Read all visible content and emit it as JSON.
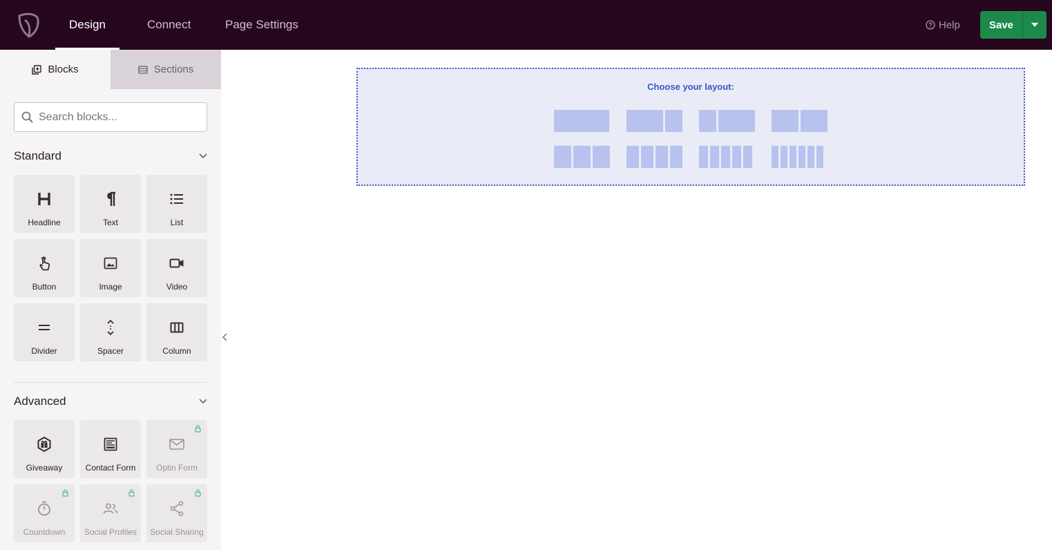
{
  "topbar": {
    "tabs": [
      {
        "label": "Design",
        "active": true
      },
      {
        "label": "Connect",
        "active": false
      },
      {
        "label": "Page Settings",
        "active": false
      }
    ],
    "help_label": "Help",
    "save_label": "Save",
    "accent_color": "#1b8a4b",
    "bar_color": "#270720"
  },
  "sidebar": {
    "tabs": [
      {
        "label": "Blocks",
        "icon": "blocks-icon",
        "active": true
      },
      {
        "label": "Sections",
        "icon": "sections-icon",
        "active": false
      }
    ],
    "search": {
      "placeholder": "Search blocks..."
    },
    "standard": {
      "title": "Standard",
      "blocks": [
        {
          "label": "Headline",
          "icon": "headline-icon"
        },
        {
          "label": "Text",
          "icon": "paragraph-icon"
        },
        {
          "label": "List",
          "icon": "list-icon"
        },
        {
          "label": "Button",
          "icon": "pointer-icon"
        },
        {
          "label": "Image",
          "icon": "image-icon"
        },
        {
          "label": "Video",
          "icon": "video-icon"
        },
        {
          "label": "Divider",
          "icon": "divider-icon"
        },
        {
          "label": "Spacer",
          "icon": "spacer-icon"
        },
        {
          "label": "Column",
          "icon": "column-icon"
        }
      ]
    },
    "advanced": {
      "title": "Advanced",
      "blocks": [
        {
          "label": "Giveaway",
          "icon": "giveaway-icon",
          "locked": false
        },
        {
          "label": "Contact Form",
          "icon": "contact-form-icon",
          "locked": false
        },
        {
          "label": "Optin Form",
          "icon": "mail-icon",
          "locked": true
        },
        {
          "label": "Countdown",
          "icon": "timer-icon",
          "locked": true
        },
        {
          "label": "Social Profiles",
          "icon": "people-icon",
          "locked": true
        },
        {
          "label": "Social Sharing",
          "icon": "share-icon",
          "locked": true
        }
      ]
    }
  },
  "canvas": {
    "layout_prompt": "Choose your layout:",
    "layouts": [
      {
        "name": "1 column"
      },
      {
        "name": "2/3 + 1/3"
      },
      {
        "name": "1/3 + 2/3"
      },
      {
        "name": "1/2 + 1/2"
      },
      {
        "name": "3 columns"
      },
      {
        "name": "4 columns"
      },
      {
        "name": "5 columns"
      },
      {
        "name": "6 columns"
      }
    ]
  }
}
